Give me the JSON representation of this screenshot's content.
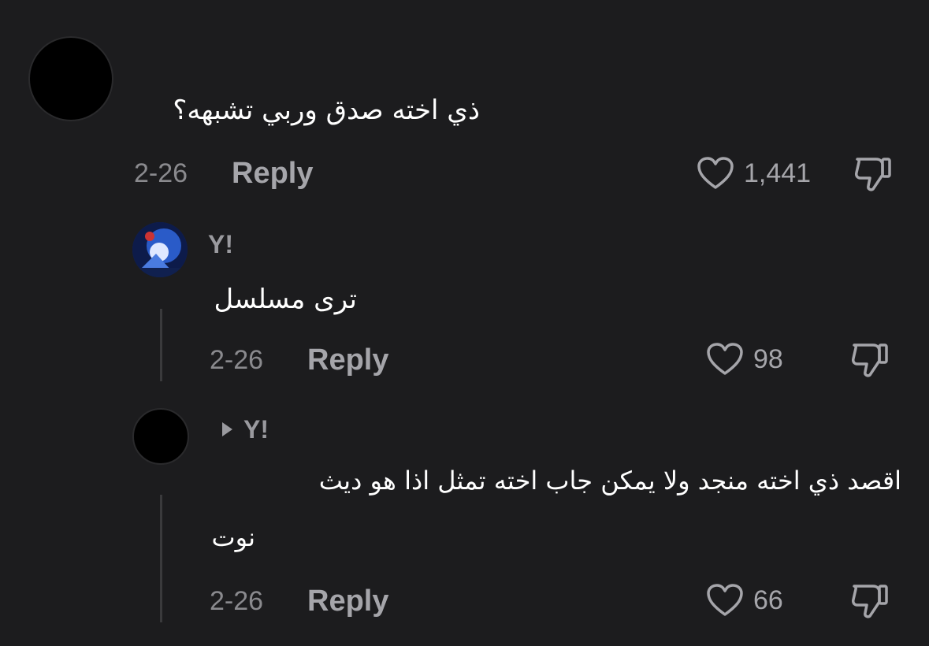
{
  "comments": [
    {
      "text": "ذي اخته صدق وربي تشبهه؟",
      "date": "2-26",
      "reply_label": "Reply",
      "likes": "1,441"
    }
  ],
  "replies": [
    {
      "username": "Y!",
      "text": "ترى مسلسل",
      "date": "2-26",
      "reply_label": "Reply",
      "likes": "98"
    },
    {
      "reply_to": "Y!",
      "text_line1": "اقصد ذي اخته منجد ولا يمكن جاب اخته تمثل اذا  هو ديث",
      "text_line2": "نوت",
      "date": "2-26",
      "reply_label": "Reply",
      "likes": "66"
    }
  ],
  "icons": {
    "like": "heart-outline-icon",
    "dislike": "thumbs-down-icon",
    "expand": "triangle-right-icon"
  },
  "colors": {
    "background": "#1c1c1e",
    "text": "#ffffff",
    "meta": "#8a8a8e",
    "thread_line": "#3a3a3c"
  }
}
